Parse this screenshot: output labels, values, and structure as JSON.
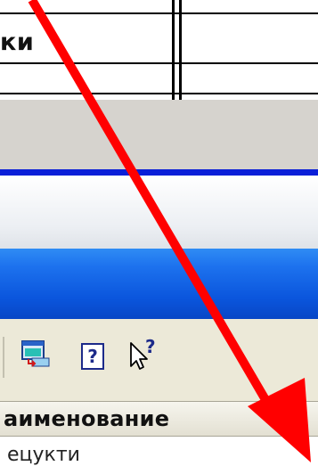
{
  "document": {
    "cell_text": "ки"
  },
  "toolbar": {
    "buttons": [
      {
        "name": "table-export-icon"
      },
      {
        "name": "help-icon",
        "glyph": "?"
      },
      {
        "name": "context-help-icon",
        "glyph": "?"
      }
    ]
  },
  "column_header": {
    "label": "аименование"
  },
  "list": {
    "first_row": "ецукти"
  },
  "colors": {
    "title_bar": "#0b56dd",
    "separator_blue": "#0a1fd8",
    "annotation_arrow": "#ff0000"
  }
}
